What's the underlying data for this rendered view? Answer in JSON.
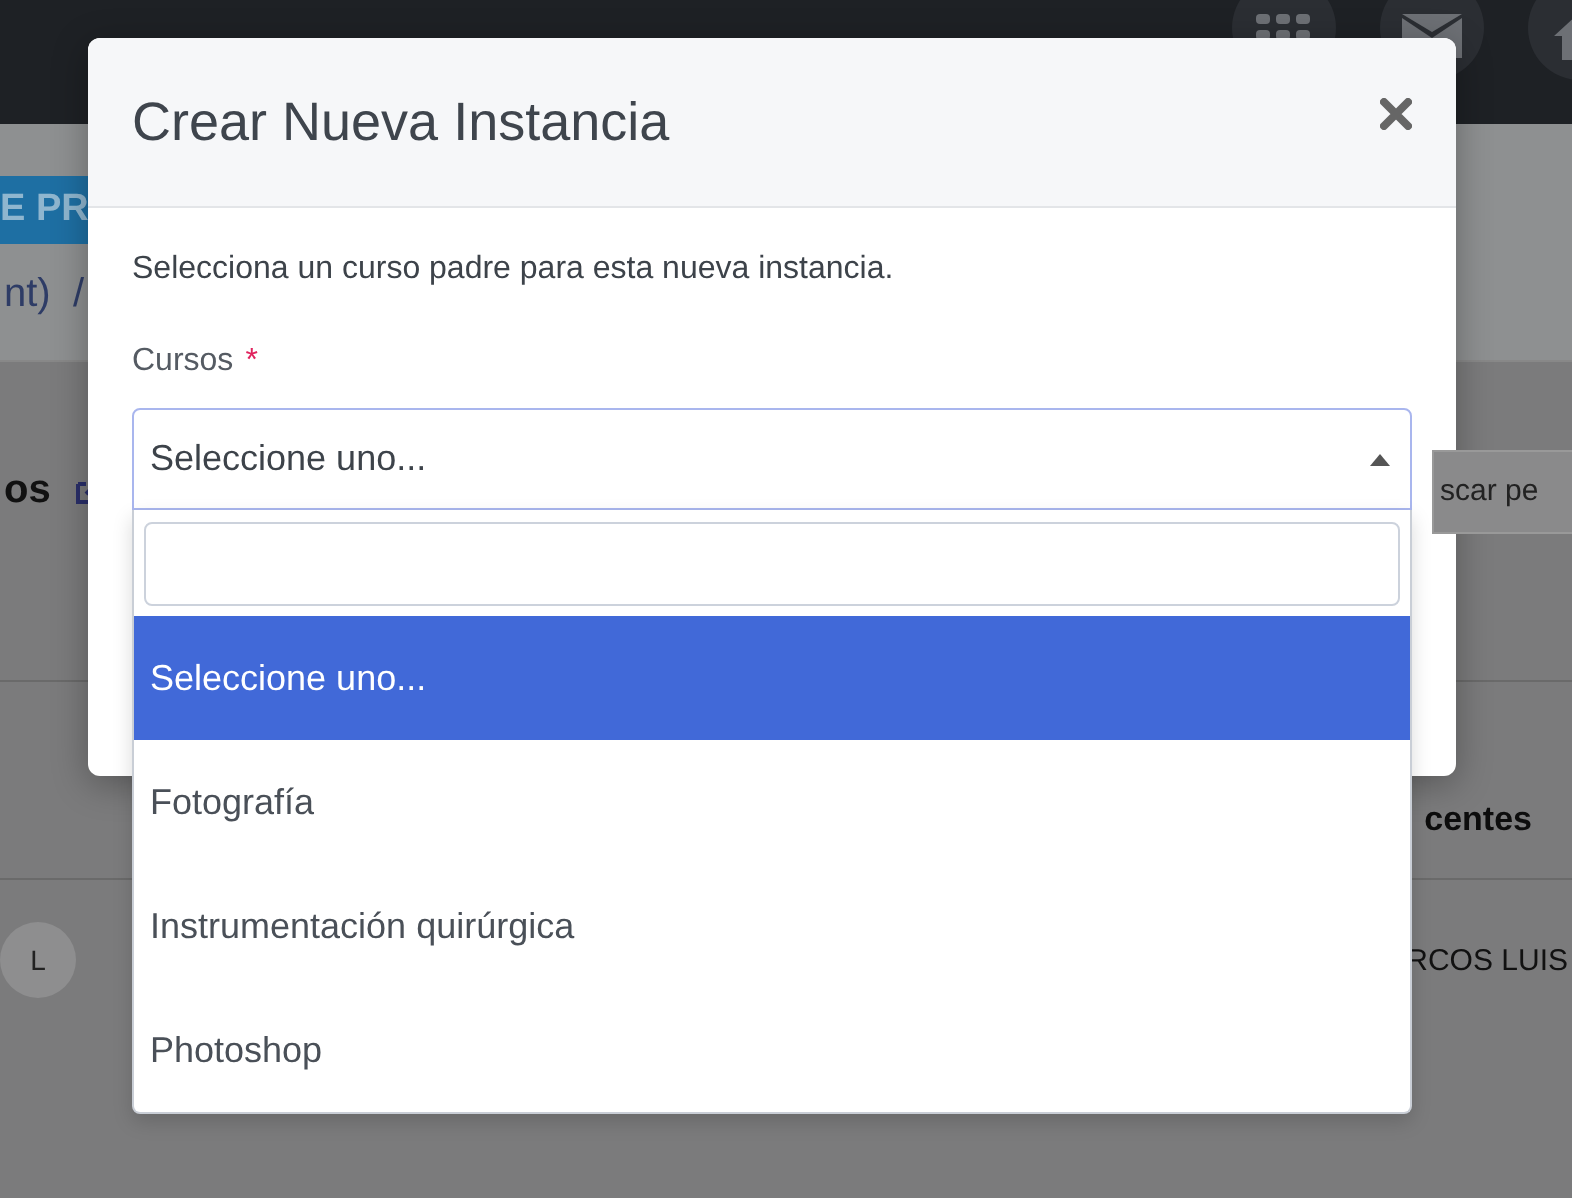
{
  "background": {
    "badge": "E PR",
    "breadcrumb": "nt)  /",
    "section_title": "os",
    "search": {
      "placeholder": "scar pe"
    },
    "table_header": "centes",
    "row_cell": "RCOS LUIS",
    "avatar_initial": "L"
  },
  "modal": {
    "title": "Crear Nueva Instancia",
    "description": "Selecciona un curso padre para esta nueva instancia.",
    "field": {
      "label": "Cursos",
      "required_mark": "*",
      "value": "Seleccione uno...",
      "expanded": true,
      "options": [
        {
          "label": "Seleccione uno...",
          "selected": true
        },
        {
          "label": "Fotografía",
          "selected": false
        },
        {
          "label": "Instrumentación quirúrgica",
          "selected": false
        },
        {
          "label": "Photoshop",
          "selected": false
        }
      ]
    }
  }
}
